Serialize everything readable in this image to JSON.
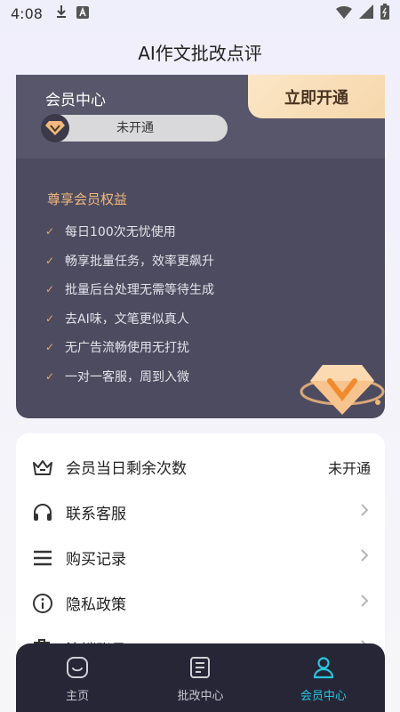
{
  "status_bar": {
    "time": "4:08"
  },
  "app": {
    "title": "AI作文批改点评"
  },
  "member_card": {
    "heading": "会员中心",
    "status": "未开通",
    "open_button": "立即开通",
    "benefits_title": "尊享会员权益",
    "benefits": [
      "每日100次无忧使用",
      "畅享批量任务，效率更飙升",
      "批量后台处理无需等待生成",
      "去AI味，文笔更似真人",
      "无广告流畅使用无打扰",
      "一对一客服，周到入微"
    ]
  },
  "menu": {
    "items": [
      {
        "label": "会员当日剩余次数",
        "value": "未开通",
        "icon": "crown-icon"
      },
      {
        "label": "联系客服",
        "icon": "headset-icon"
      },
      {
        "label": "购买记录",
        "icon": "list-icon"
      },
      {
        "label": "隐私政策",
        "icon": "info-icon"
      },
      {
        "label": "注销账号",
        "icon": "trash-icon"
      }
    ]
  },
  "bottom_nav": {
    "items": [
      {
        "label": "主页",
        "icon": "home-icon"
      },
      {
        "label": "批改中心",
        "icon": "document-icon"
      },
      {
        "label": "会员中心",
        "icon": "user-icon"
      }
    ],
    "active_index": 2
  },
  "colors": {
    "accent": "#25c7df",
    "card_dark": "#4d4b5f",
    "gold": "#f2b87c",
    "nav_bg": "#262637"
  }
}
